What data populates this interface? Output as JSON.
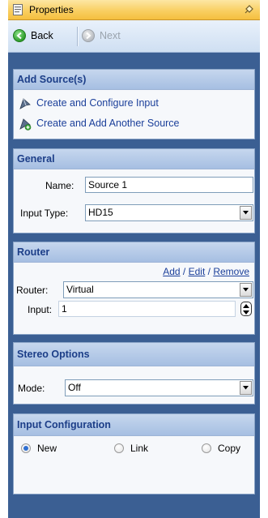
{
  "window": {
    "title": "Properties",
    "icons": {
      "title": "properties-icon",
      "pin": "pin-icon"
    }
  },
  "toolbar": {
    "back_label": "Back",
    "next_label": "Next",
    "icons": {
      "back": "back-arrow-icon",
      "next": "next-arrow-icon"
    }
  },
  "add_sources": {
    "header": "Add Source(s)",
    "items": [
      {
        "label": "Create and Configure Input",
        "icon": "create-input-icon"
      },
      {
        "label": "Create and Add Another Source",
        "icon": "add-source-icon"
      }
    ]
  },
  "general": {
    "header": "General",
    "name_label": "Name:",
    "name_value": "Source 1",
    "input_type_label": "Input Type:",
    "input_type_value": "HD15"
  },
  "router": {
    "header": "Router",
    "add_link": "Add",
    "edit_link": "Edit",
    "remove_link": "Remove",
    "link_separator": "/",
    "router_label": "Router:",
    "router_value": "Virtual",
    "input_label": "Input:",
    "input_value": "1"
  },
  "stereo": {
    "header": "Stereo Options",
    "mode_label": "Mode:",
    "mode_value": "Off"
  },
  "input_config": {
    "header": "Input Configuration",
    "options": [
      {
        "label": "New",
        "selected": true
      },
      {
        "label": "Link",
        "selected": false
      },
      {
        "label": "Copy",
        "selected": false
      }
    ]
  },
  "colors": {
    "frame_bg": "#3b5f93",
    "section_header_text": "#1c3e88",
    "link_text": "#1b3f9a",
    "titlebar": "#f9cf63"
  }
}
